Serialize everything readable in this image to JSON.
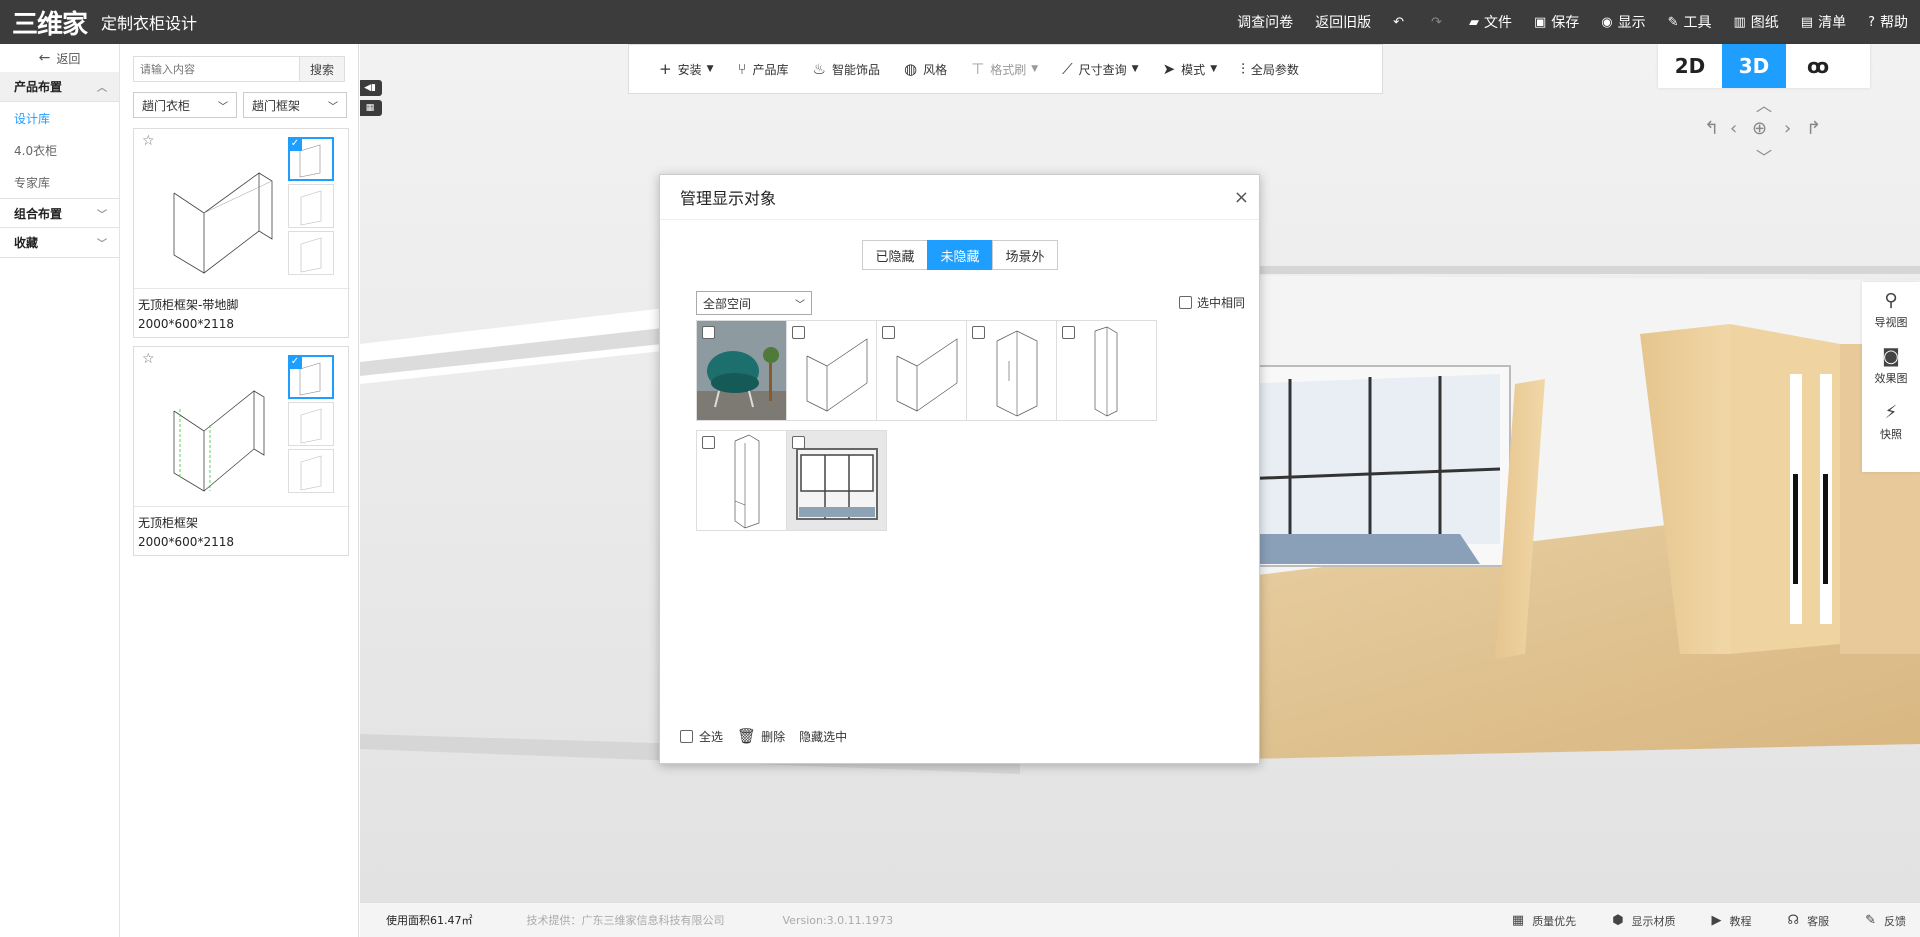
{
  "app": {
    "logo_text": "三维家",
    "title": "定制衣柜设计"
  },
  "top_menu": [
    {
      "label": "调查问卷",
      "icon": "",
      "icon_name": "survey"
    },
    {
      "label": "返回旧版",
      "icon": "",
      "icon_name": "old-version"
    },
    {
      "label": "",
      "icon": "↶",
      "icon_name": "undo-icon"
    },
    {
      "label": "",
      "icon": "↷",
      "icon_name": "redo-icon"
    },
    {
      "label": "文件",
      "icon": "▰",
      "icon_name": "folder-icon"
    },
    {
      "label": "保存",
      "icon": "▣",
      "icon_name": "save-icon"
    },
    {
      "label": "显示",
      "icon": "◉",
      "icon_name": "eye-icon"
    },
    {
      "label": "工具",
      "icon": "✎",
      "icon_name": "wrench-icon"
    },
    {
      "label": "图纸",
      "icon": "▥",
      "icon_name": "map-icon"
    },
    {
      "label": "清单",
      "icon": "▤",
      "icon_name": "list-icon"
    },
    {
      "label": "帮助",
      "icon": "?",
      "icon_name": "help-icon"
    }
  ],
  "left_nav": {
    "back_label": "返回",
    "group1": "产品布置",
    "items": [
      "设计库",
      "4.0衣柜",
      "专家库"
    ],
    "group2": "组合布置",
    "group3": "收藏"
  },
  "product_panel": {
    "search_placeholder": "请输入内容",
    "search_button": "搜索",
    "filter1": "趟门衣柜",
    "filter2": "趟门框架",
    "products": [
      {
        "name": "无顶柜框架-带地脚",
        "size": "2000*600*2118"
      },
      {
        "name": "无顶柜框架",
        "size": "2000*600*2118"
      }
    ]
  },
  "toolbar": [
    {
      "label": "安装",
      "icon": "+",
      "caret": true,
      "dim": false,
      "icon_name": "plus-icon"
    },
    {
      "label": "产品库",
      "icon": "⑂",
      "caret": false,
      "dim": false,
      "icon_name": "chair-icon"
    },
    {
      "label": "智能饰品",
      "icon": "♨",
      "caret": false,
      "dim": false,
      "icon_name": "plant-icon"
    },
    {
      "label": "风格",
      "icon": "◍",
      "caret": false,
      "dim": false,
      "icon_name": "palette-icon"
    },
    {
      "label": "格式刷",
      "icon": "⊤",
      "caret": true,
      "dim": true,
      "icon_name": "brush-icon"
    },
    {
      "label": "尺寸查询",
      "icon": "⟋",
      "caret": true,
      "dim": false,
      "icon_name": "ruler-icon"
    },
    {
      "label": "模式",
      "icon": "➤",
      "caret": true,
      "dim": false,
      "icon_name": "cursor-icon"
    },
    {
      "label": "全局参数",
      "icon": "⫶",
      "caret": false,
      "dim": false,
      "icon_name": "sliders-icon"
    }
  ],
  "view_toggle": {
    "v2d": "2D",
    "v3d": "3D",
    "walk": "ꝏ"
  },
  "right_dock": [
    {
      "label": "导视图",
      "icon": "⚲",
      "icon_name": "navigate-icon"
    },
    {
      "label": "效果图",
      "icon": "◙",
      "icon_name": "camera-icon"
    },
    {
      "label": "快照",
      "icon": "⚡",
      "icon_name": "snapshot-icon"
    }
  ],
  "status": {
    "area": "使用面积61.47㎡",
    "tech": "技术提供：广东三维家信息科技有限公司",
    "version": "Version:3.0.11.1973",
    "right": [
      {
        "label": "质量优先",
        "icon": "▦",
        "icon_name": "quality-icon"
      },
      {
        "label": "显示材质",
        "icon": "⬢",
        "icon_name": "material-icon"
      },
      {
        "label": "教程",
        "icon": "▶",
        "icon_name": "tutorial-icon"
      },
      {
        "label": "客服",
        "icon": "☊",
        "icon_name": "service-icon"
      },
      {
        "label": "反馈",
        "icon": "✎",
        "icon_name": "feedback-icon"
      }
    ]
  },
  "dialog": {
    "title": "管理显示对象",
    "close": "×",
    "tabs": [
      "已隐藏",
      "未隐藏",
      "场景外"
    ],
    "active_tab": 1,
    "space_select": "全部空间",
    "select_same": "选中相同",
    "select_all": "全选",
    "delete": "删除",
    "hide_selected": "隐藏选中"
  },
  "colors": {
    "accent": "#1e9fff",
    "topbar": "#3c3c3c"
  }
}
